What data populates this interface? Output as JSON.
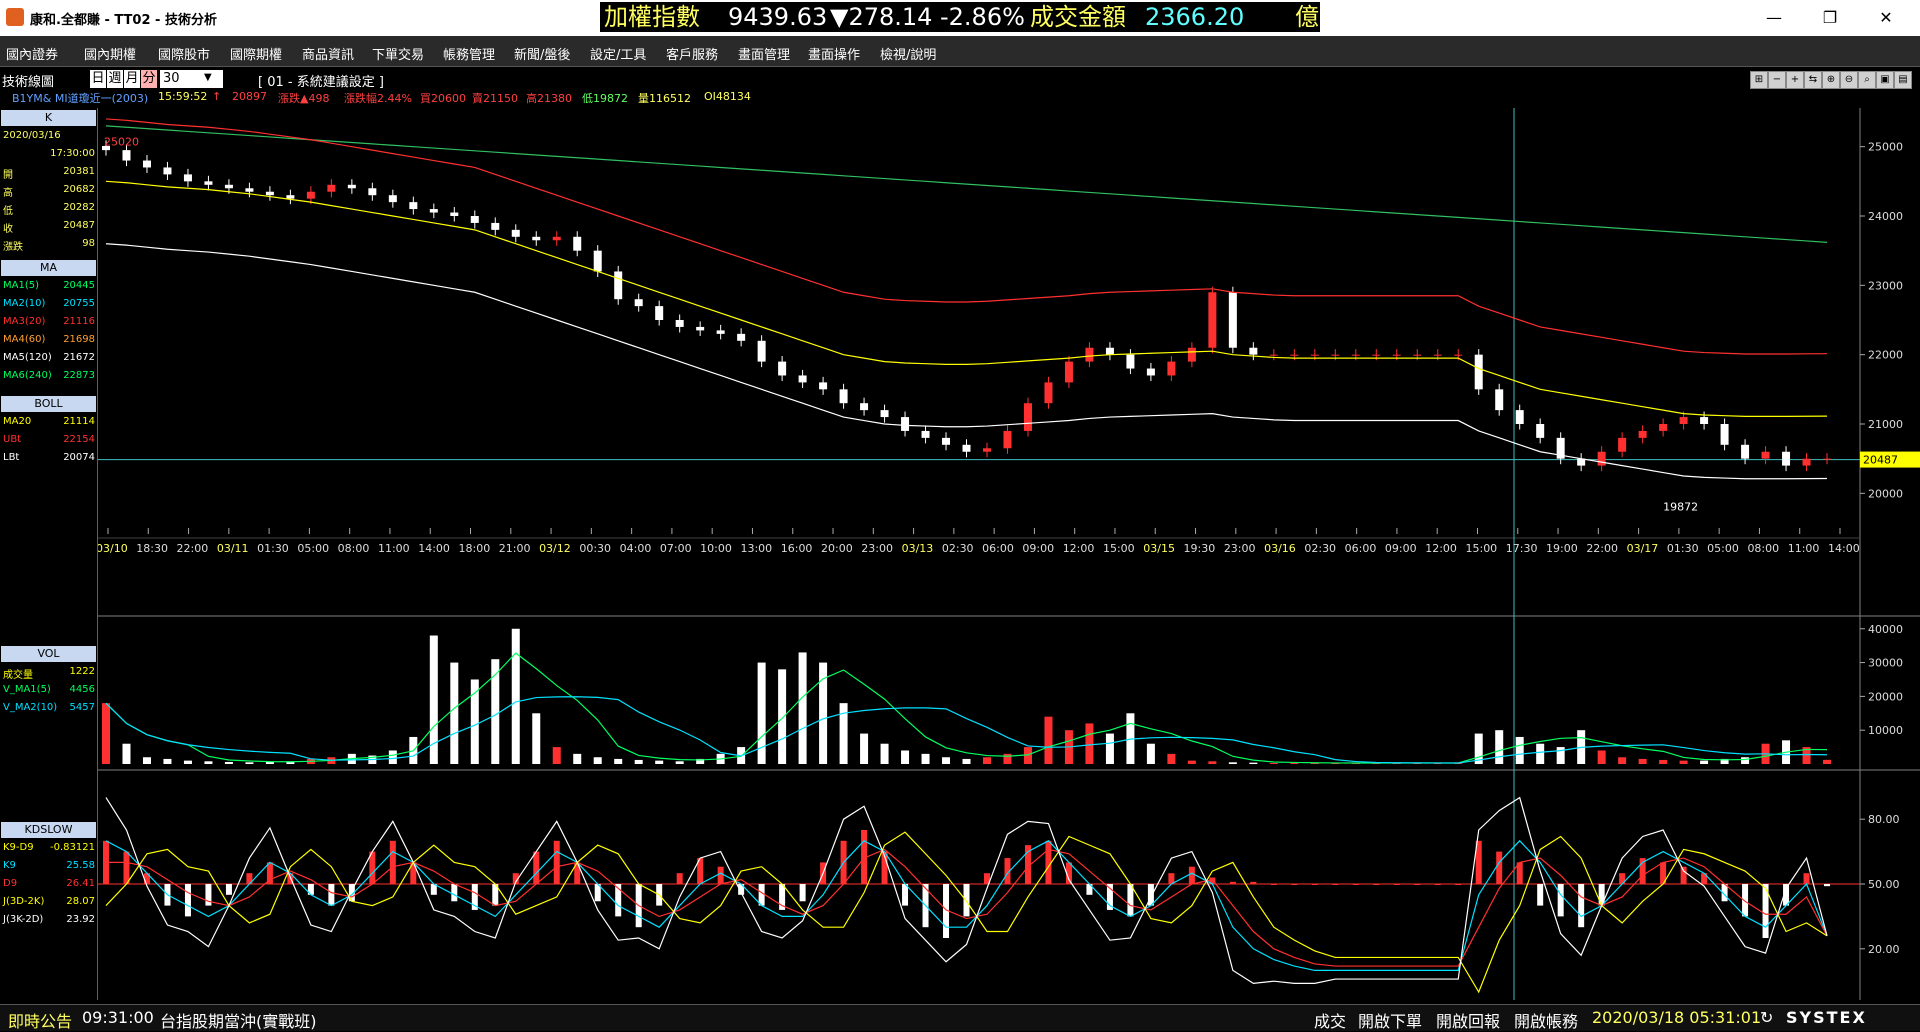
{
  "window": {
    "title": "康和.全都賺 - TT02 - 技術分析"
  },
  "ticker": {
    "label": "加權指數",
    "value": "9439.63",
    "change": "▼278.14",
    "pct": "-2.86%",
    "amount_label": "成交金額",
    "amount": "2366.20",
    "unit": "億"
  },
  "window_controls": {
    "minimize": "—",
    "maximize": "❐",
    "close": "✕"
  },
  "menu": [
    "國內證券",
    "國內期權",
    "國際股市",
    "國際期權",
    "商品資訊",
    "下單交易",
    "帳務管理",
    "新聞/盤後",
    "設定/工具",
    "客戶服務",
    "畫面管理",
    "畫面操作",
    "檢視/說明"
  ],
  "toolbar": {
    "title": "技術線圖",
    "periods": [
      "日",
      "週",
      "月",
      "分"
    ],
    "interval": "30",
    "preset": "[ 01 - 系統建議設定 ]"
  },
  "infoline": {
    "symbol": "B1YM&  MI道瓊近一(2003)",
    "time": "15:59:52",
    "arrow": "↑",
    "price": "20897",
    "chg": "漲跌▲498",
    "chgpct": "漲跌幅2.44%",
    "open": "買20600",
    "sell": "賣21150",
    "high": "高21380",
    "low": "低19872",
    "vol": "量116512",
    "oi": "OI48134"
  },
  "side_k": {
    "header": "K",
    "date": "2020/03/16",
    "time": "17:30:00",
    "rows": [
      {
        "label": "開",
        "value": "20381"
      },
      {
        "label": "高",
        "value": "20682"
      },
      {
        "label": "低",
        "value": "20282"
      },
      {
        "label": "收",
        "value": "20487"
      },
      {
        "label": "漲跌",
        "value": "98"
      }
    ]
  },
  "side_ma": {
    "header": "MA",
    "rows": [
      {
        "label": "MA1(5)",
        "value": "20445",
        "color": "#00ff60"
      },
      {
        "label": "MA2(10)",
        "value": "20755",
        "color": "#00e0ff"
      },
      {
        "label": "MA3(20)",
        "value": "21116",
        "color": "#ff3030"
      },
      {
        "label": "MA4(60)",
        "value": "21698",
        "color": "#ffa030"
      },
      {
        "label": "MA5(120)",
        "value": "21672",
        "color": "#ffffff"
      },
      {
        "label": "MA6(240)",
        "value": "22873",
        "color": "#00ff60"
      }
    ]
  },
  "side_boll": {
    "header": "BOLL",
    "rows": [
      {
        "label": "MA20",
        "value": "21114",
        "color": "#ffff00"
      },
      {
        "label": "UBt",
        "value": "22154",
        "color": "#ff3030"
      },
      {
        "label": "LBt",
        "value": "20074",
        "color": "#ffffff"
      }
    ]
  },
  "side_vol": {
    "header": "VOL",
    "rows": [
      {
        "label": "成交量",
        "value": "1222",
        "color": "#ffff00"
      },
      {
        "label": "V_MA1(5)",
        "value": "4456",
        "color": "#00ff60"
      },
      {
        "label": "V_MA2(10)",
        "value": "5457",
        "color": "#00e0ff"
      }
    ]
  },
  "side_kd": {
    "header": "KDSLOW",
    "rows": [
      {
        "label": "K9-D9",
        "value": "-0.83121",
        "color": "#ffff00"
      },
      {
        "label": "K9",
        "value": "25.58",
        "color": "#00e0ff"
      },
      {
        "label": "D9",
        "value": "26.41",
        "color": "#ff3030"
      },
      {
        "label": "J(3D-2K)",
        "value": "28.07",
        "color": "#ffff00"
      },
      {
        "label": "J(3K-2D)",
        "value": "23.92",
        "color": "#ffffff"
      }
    ]
  },
  "chart_data": [
    {
      "type": "candlestick",
      "name": "K",
      "y_ticks": [
        "25000",
        "24000",
        "23000",
        "22000",
        "21000",
        "20000"
      ],
      "ylim": [
        19500,
        25500
      ],
      "x_ticks": [
        "03/10",
        "18:30",
        "22:00",
        "03/11",
        "01:30",
        "05:00",
        "08:00",
        "11:00",
        "14:00",
        "18:00",
        "21:00",
        "03/12",
        "00:30",
        "04:00",
        "07:00",
        "10:00",
        "13:00",
        "16:00",
        "20:00",
        "23:00",
        "03/13",
        "02:30",
        "06:00",
        "09:00",
        "12:00",
        "15:00",
        "03/15",
        "19:30",
        "23:00",
        "03/16",
        "02:30",
        "06:00",
        "09:00",
        "12:00",
        "15:00",
        "17:30",
        "19:00",
        "22:00",
        "03/17",
        "01:30",
        "05:00",
        "08:00",
        "11:00",
        "14:00"
      ],
      "annotations": [
        "25020",
        "19872"
      ],
      "last_price_label": "20487",
      "hline": 20487,
      "close": [
        24950,
        24800,
        24700,
        24600,
        24500,
        24450,
        24400,
        24350,
        24300,
        24250,
        24350,
        24450,
        24400,
        24300,
        24200,
        24100,
        24050,
        24000,
        23900,
        23800,
        23700,
        23650,
        23700,
        23500,
        23200,
        22800,
        22700,
        22500,
        22400,
        22350,
        22300,
        22200,
        21900,
        21700,
        21600,
        21500,
        21300,
        21200,
        21100,
        20900,
        20800,
        20700,
        20600,
        20650,
        20900,
        21300,
        21600,
        21900,
        22100,
        22000,
        21800,
        21700,
        21900,
        22100,
        22900,
        22100,
        22000,
        22000,
        22000,
        22000,
        22000,
        22000,
        22000,
        22000,
        22000,
        22000,
        22000,
        21500,
        21200,
        21000,
        20800,
        20500,
        20400,
        20600,
        20800,
        20900,
        21000,
        21100,
        21000,
        20700,
        20500,
        20600,
        20400,
        20500,
        20500
      ],
      "ma20": [
        24500,
        24480,
        24450,
        24420,
        24400,
        24380,
        24350,
        24320,
        24280,
        24240,
        24200,
        24150,
        24100,
        24050,
        24000,
        23950,
        23900,
        23850,
        23800,
        23700,
        23600,
        23500,
        23400,
        23300,
        23200,
        23100,
        23000,
        22900,
        22800,
        22700,
        22600,
        22500,
        22400,
        22300,
        22200,
        22100,
        22000,
        21950,
        21900,
        21880,
        21870,
        21860,
        21860,
        21870,
        21890,
        21910,
        21930,
        21950,
        21980,
        22000,
        22010,
        22020,
        22030,
        22040,
        22050,
        22000,
        21980,
        21960,
        21950,
        21950,
        21950,
        21950,
        21950,
        21950,
        21950,
        21950,
        21950,
        21800,
        21700,
        21600,
        21500,
        21450,
        21400,
        21350,
        21300,
        21250,
        21200,
        21150,
        21130,
        21120,
        21110,
        21110,
        21110,
        21112,
        21114
      ],
      "ma240": [
        25300,
        25280,
        25260,
        25240,
        25220,
        25200,
        25180,
        25160,
        25140,
        25120,
        25100,
        25080,
        25060,
        25040,
        25020,
        25000,
        24980,
        24960,
        24940,
        24920,
        24900,
        24880,
        24860,
        24840,
        24820,
        24800,
        24780,
        24760,
        24740,
        24720,
        24700,
        24680,
        24660,
        24640,
        24620,
        24600,
        24580,
        24560,
        24540,
        24520,
        24500,
        24480,
        24460,
        24440,
        24420,
        24400,
        24380,
        24360,
        24340,
        24320,
        24300,
        24280,
        24260,
        24240,
        24220,
        24200,
        24180,
        24160,
        24140,
        24120,
        24100,
        24080,
        24060,
        24040,
        24020,
        24000,
        23980,
        23960,
        23940,
        23920,
        23900,
        23880,
        23860,
        23840,
        23820,
        23800,
        23780,
        23760,
        23740,
        23720,
        23700,
        23680,
        23660,
        23640,
        23620
      ]
    },
    {
      "type": "bar",
      "name": "VOL",
      "y_ticks": [
        "40000",
        "30000",
        "20000",
        "10000"
      ],
      "ylim": [
        0,
        42000
      ],
      "values": [
        18000,
        6000,
        2000,
        1500,
        1000,
        800,
        600,
        500,
        600,
        800,
        1500,
        2000,
        3000,
        2500,
        4000,
        8000,
        38000,
        30000,
        25000,
        31000,
        40000,
        15000,
        5000,
        3000,
        2000,
        1500,
        1200,
        1000,
        800,
        1500,
        3000,
        5000,
        30000,
        28000,
        33000,
        30000,
        18000,
        9000,
        6000,
        4000,
        3000,
        2000,
        1500,
        2000,
        3000,
        5000,
        14000,
        10000,
        12000,
        9000,
        15000,
        6000,
        3000,
        1000,
        800,
        500,
        400,
        300,
        300,
        300,
        300,
        300,
        300,
        300,
        300,
        300,
        300,
        9000,
        10000,
        8000,
        6000,
        5000,
        10000,
        4000,
        2000,
        1500,
        1200,
        1000,
        1000,
        1500,
        2000,
        6000,
        7000,
        5000,
        1222
      ]
    },
    {
      "type": "bar",
      "name": "KDSLOW",
      "y_ticks": [
        "80.00",
        "50.00",
        "20.00"
      ],
      "ylim": [
        0,
        100
      ],
      "values": [
        20,
        15,
        5,
        -10,
        -15,
        -10,
        -5,
        5,
        10,
        5,
        -5,
        -10,
        -8,
        15,
        20,
        10,
        -5,
        -8,
        -12,
        -10,
        5,
        15,
        20,
        10,
        -8,
        -15,
        -20,
        -10,
        5,
        12,
        8,
        -5,
        -10,
        -12,
        -8,
        10,
        20,
        25,
        15,
        -10,
        -20,
        -25,
        -15,
        5,
        12,
        18,
        20,
        10,
        -5,
        -12,
        -15,
        -10,
        5,
        8,
        3,
        1,
        1,
        0,
        0,
        0,
        0,
        0,
        0,
        0,
        0,
        0,
        0,
        20,
        15,
        10,
        -10,
        -15,
        -20,
        -10,
        5,
        12,
        10,
        8,
        5,
        -8,
        -15,
        -25,
        -10,
        5,
        -1
      ],
      "k9": [
        70,
        65,
        55,
        45,
        40,
        35,
        40,
        50,
        60,
        55,
        45,
        40,
        45,
        55,
        65,
        60,
        50,
        45,
        40,
        35,
        45,
        55,
        65,
        60,
        50,
        40,
        35,
        30,
        40,
        50,
        55,
        50,
        40,
        35,
        35,
        45,
        60,
        70,
        65,
        50,
        40,
        30,
        30,
        40,
        55,
        65,
        70,
        60,
        50,
        40,
        35,
        40,
        50,
        55,
        50,
        30,
        20,
        15,
        12,
        10,
        10,
        10,
        10,
        10,
        10,
        10,
        10,
        45,
        60,
        70,
        60,
        45,
        35,
        40,
        50,
        60,
        65,
        60,
        55,
        45,
        35,
        30,
        40,
        50,
        26
      ],
      "d9": [
        60,
        60,
        58,
        52,
        46,
        42,
        40,
        44,
        52,
        56,
        52,
        46,
        44,
        50,
        58,
        60,
        56,
        50,
        46,
        40,
        42,
        50,
        58,
        60,
        56,
        48,
        40,
        35,
        38,
        44,
        50,
        52,
        46,
        40,
        36,
        40,
        50,
        62,
        66,
        58,
        48,
        38,
        34,
        36,
        46,
        58,
        66,
        64,
        56,
        48,
        40,
        38,
        44,
        50,
        52,
        40,
        28,
        20,
        16,
        13,
        12,
        12,
        12,
        12,
        12,
        12,
        12,
        30,
        48,
        60,
        62,
        54,
        44,
        40,
        44,
        54,
        60,
        62,
        58,
        50,
        42,
        36,
        36,
        44,
        26
      ]
    }
  ]
}
